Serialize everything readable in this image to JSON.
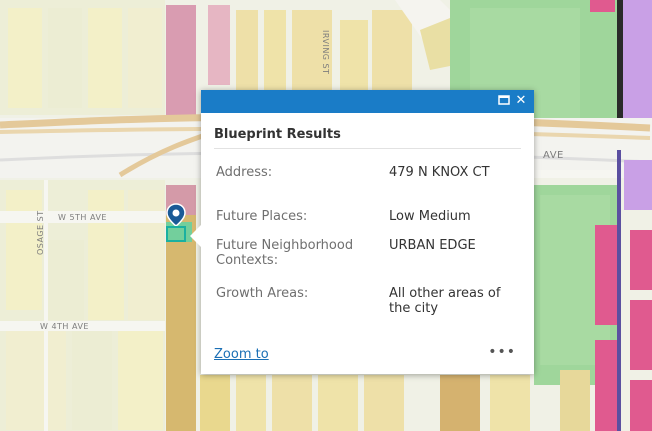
{
  "map": {
    "street_labels": [
      "W 5TH AVE",
      "W 4TH AVE",
      "IRVING ST",
      "AVE",
      "OSAGE ST"
    ]
  },
  "popup": {
    "title": "Blueprint Results",
    "fields": [
      {
        "label": "Address:",
        "value": "479 N KNOX CT"
      },
      {
        "label": "Future Places:",
        "value": "Low Medium"
      },
      {
        "label": "Future Neighborhood Contexts:",
        "value": "URBAN EDGE"
      },
      {
        "label": "Growth Areas:",
        "value": "All other areas of the city"
      }
    ],
    "zoom_label": "Zoom to",
    "more_label": "•••",
    "maximize_icon": "maximize-icon",
    "close_icon": "close-icon"
  },
  "colors": {
    "header": "#1a7cc7",
    "link": "#1a6fb5",
    "marker": "#1a5a96"
  }
}
